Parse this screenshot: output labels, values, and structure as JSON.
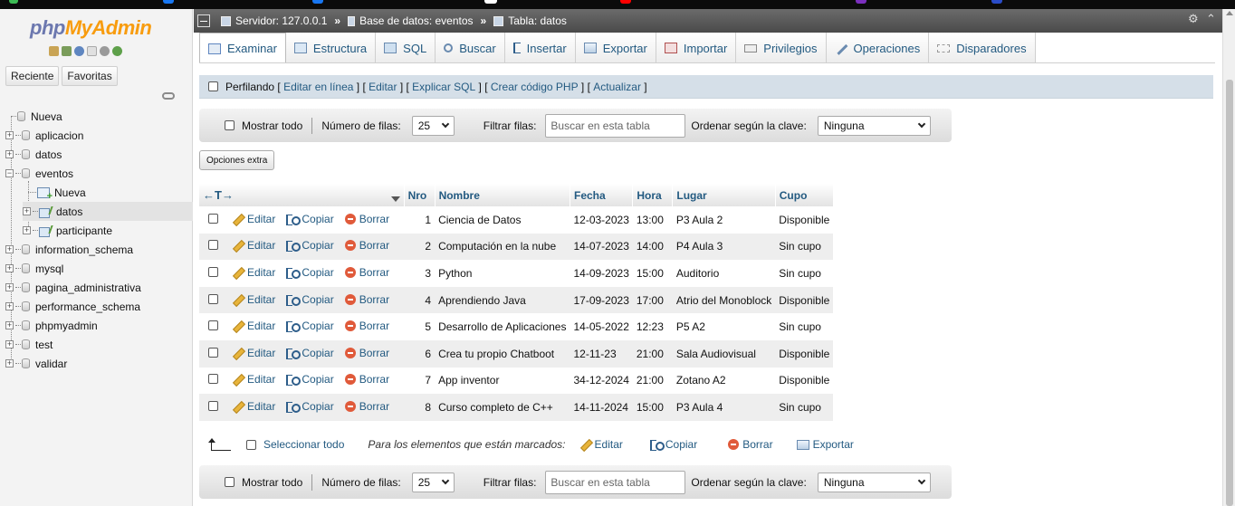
{
  "logo": {
    "php": "php",
    "myadmin": "MyAdmin"
  },
  "nav": {
    "tabs": [
      "Reciente",
      "Favoritas"
    ],
    "tree": [
      {
        "label": "Nueva",
        "level": 0
      },
      {
        "label": "aplicacion",
        "level": 0
      },
      {
        "label": "datos",
        "level": 0
      },
      {
        "label": "eventos",
        "level": 0
      },
      {
        "label": "Nueva",
        "level": 1
      },
      {
        "label": "datos",
        "level": 1
      },
      {
        "label": "participante",
        "level": 1
      },
      {
        "label": "information_schema",
        "level": 0
      },
      {
        "label": "mysql",
        "level": 0
      },
      {
        "label": "pagina_administrativa",
        "level": 0
      },
      {
        "label": "performance_schema",
        "level": 0
      },
      {
        "label": "phpmyadmin",
        "level": 0
      },
      {
        "label": "test",
        "level": 0
      },
      {
        "label": "validar",
        "level": 0
      }
    ]
  },
  "breadcrumb": {
    "server": "Servidor: 127.0.0.1",
    "database": "Base de datos: eventos",
    "table": "Tabla: datos",
    "separator": "»"
  },
  "tabs": [
    {
      "label": "Examinar",
      "icon": "browse-icon",
      "active": true
    },
    {
      "label": "Estructura",
      "icon": "structure-icon"
    },
    {
      "label": "SQL",
      "icon": "sql-icon"
    },
    {
      "label": "Buscar",
      "icon": "search-icon"
    },
    {
      "label": "Insertar",
      "icon": "insert-icon"
    },
    {
      "label": "Exportar",
      "icon": "export-icon"
    },
    {
      "label": "Importar",
      "icon": "import-icon"
    },
    {
      "label": "Privilegios",
      "icon": "privileges-icon"
    },
    {
      "label": "Operaciones",
      "icon": "wrench-icon"
    },
    {
      "label": "Disparadores",
      "icon": "triggers-icon"
    }
  ],
  "profiling": {
    "label": "Perfilando",
    "links": [
      "Editar en línea",
      "Editar",
      "Explicar SQL",
      "Crear código PHP",
      "Actualizar"
    ]
  },
  "navbar": {
    "show_all": "Mostrar todo",
    "rows_label": "Número de filas:",
    "rows_value": "25",
    "filter_label": "Filtrar filas:",
    "filter_placeholder": "Buscar en esta tabla",
    "sort_label": "Ordenar según la clave:",
    "sort_value": "Ninguna"
  },
  "extra_options": "Opciones extra",
  "table": {
    "sort_arrows": "←T→",
    "columns": [
      "Nro",
      "Nombre",
      "Fecha",
      "Hora",
      "Lugar",
      "Cupo"
    ],
    "actions": {
      "edit": "Editar",
      "copy": "Copiar",
      "delete": "Borrar"
    },
    "rows": [
      {
        "nro": "1",
        "nombre": "Ciencia de Datos",
        "fecha": "12-03-2023",
        "hora": "13:00",
        "lugar": "P3 Aula 2",
        "cupo": "Disponible"
      },
      {
        "nro": "2",
        "nombre": "Computación en la nube",
        "fecha": "14-07-2023",
        "hora": "14:00",
        "lugar": "P4 Aula 3",
        "cupo": "Sin cupo"
      },
      {
        "nro": "3",
        "nombre": "Python",
        "fecha": "14-09-2023",
        "hora": "15:00",
        "lugar": "Auditorio",
        "cupo": "Sin cupo"
      },
      {
        "nro": "4",
        "nombre": "Aprendiendo Java",
        "fecha": "17-09-2023",
        "hora": "17:00",
        "lugar": "Atrio del Monoblock",
        "cupo": "Disponible"
      },
      {
        "nro": "5",
        "nombre": "Desarrollo de Aplicaciones",
        "fecha": "14-05-2022",
        "hora": "12:23",
        "lugar": "P5 A2",
        "cupo": "Sin cupo"
      },
      {
        "nro": "6",
        "nombre": "Crea tu propio Chatboot",
        "fecha": "12-11-23",
        "hora": "21:00",
        "lugar": "Sala Audiovisual",
        "cupo": "Disponible"
      },
      {
        "nro": "7",
        "nombre": "App inventor",
        "fecha": "34-12-2024",
        "hora": "21:00",
        "lugar": "Zotano A2",
        "cupo": "Disponible"
      },
      {
        "nro": "8",
        "nombre": "Curso completo de C++",
        "fecha": "14-11-2024",
        "hora": "15:00",
        "lugar": "P3 Aula 4",
        "cupo": "Sin cupo"
      }
    ]
  },
  "bulk": {
    "select_all": "Seleccionar todo",
    "marked_label": "Para los elementos que están marcados:",
    "edit": "Editar",
    "copy": "Copiar",
    "delete": "Borrar",
    "export": "Exportar"
  },
  "colors": {
    "link": "#235a81",
    "logo_php": "#6c78af",
    "logo_myadmin": "#f89c0e",
    "row_alt": "#eeeeee"
  }
}
